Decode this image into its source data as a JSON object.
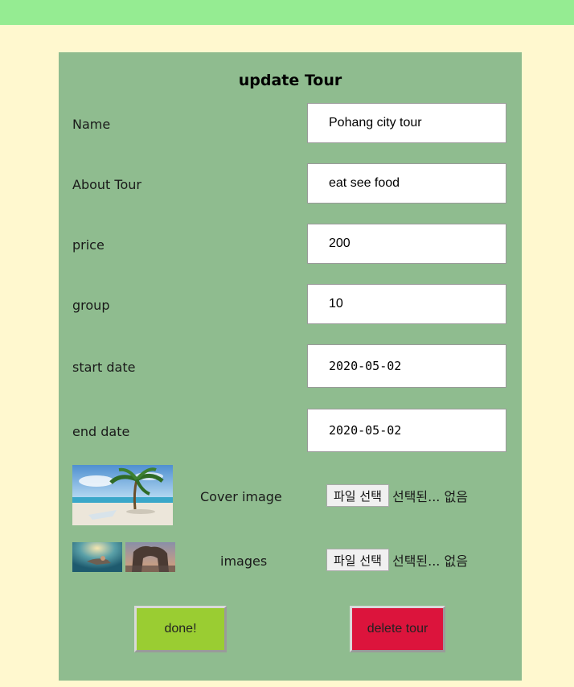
{
  "form": {
    "title": "update Tour",
    "fields": [
      {
        "label": "Name",
        "value": "Pohang city tour"
      },
      {
        "label": "About Tour",
        "value": "eat see food"
      },
      {
        "label": "price",
        "value": "200"
      },
      {
        "label": "group",
        "value": "10"
      },
      {
        "label": "start date",
        "value": "2020-05-02"
      },
      {
        "label": "end date",
        "value": "2020-05-02"
      }
    ],
    "cover_image": {
      "label": "Cover image",
      "file_button": "파일 선택",
      "file_status": "선택된... 없음"
    },
    "images": {
      "label": "images",
      "file_button": "파일 선택",
      "file_status": "선택된... 없음"
    },
    "done_label": "done!",
    "delete_label": "delete tour"
  },
  "colors": {
    "topbar": "#95ec92",
    "background": "#fff8cf",
    "panel": "#8fbc8f",
    "done": "#9acd32",
    "delete": "#dc143c"
  }
}
